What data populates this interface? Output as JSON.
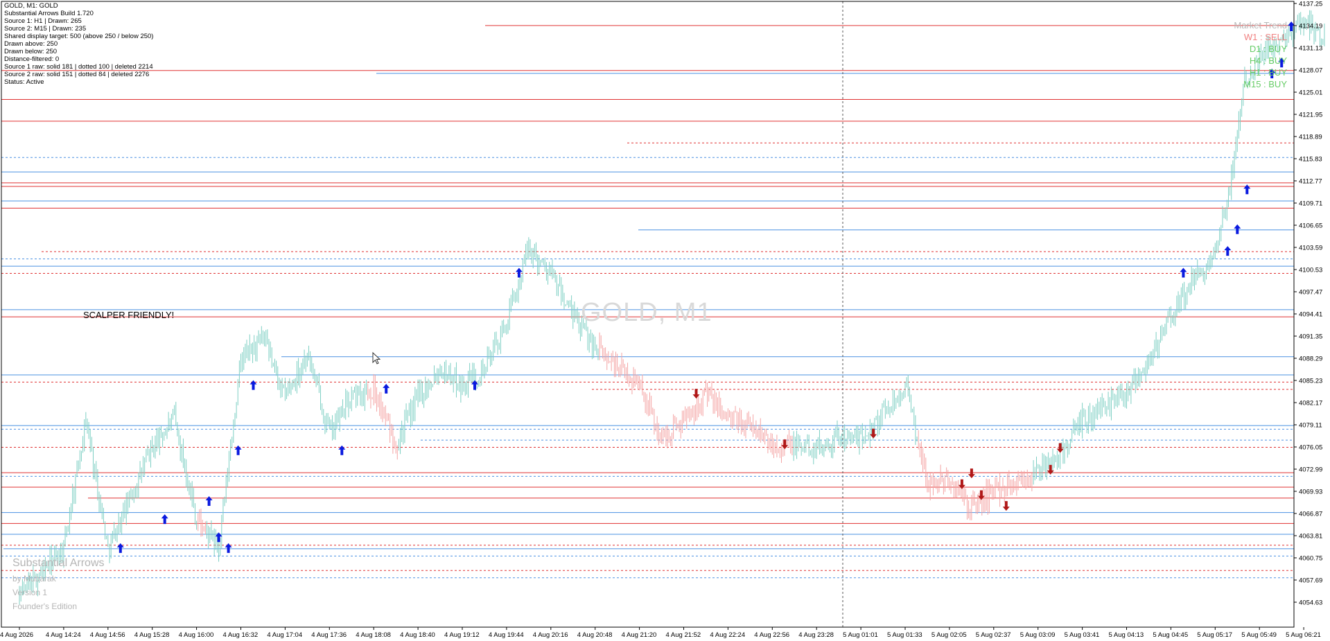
{
  "window": {
    "symbol": "GOLD, M1",
    "title_line": "GOLD, M1:  GOLD"
  },
  "info_panel": [
    "GOLD, M1:  GOLD",
    "Substantial Arrows Build 1.720",
    "Source 1: H1 | Drawn: 265",
    "Source 2: M15 | Drawn: 235",
    "Shared display target: 500 (above 250 / below 250)",
    "Drawn above: 250",
    "Drawn below: 250",
    "Distance-filtered: 0",
    "Source 1 raw: solid 181 | dotted 100 | deleted 2214",
    "Source 2 raw: solid 151 | dotted 84 | deleted 2276",
    "Status: Active"
  ],
  "scalper_text": "SCALPER FRIENDLY!",
  "watermark": "GOLD, M1",
  "branding": {
    "title": "Substantial Arrows",
    "author": "by Mubarak",
    "version": "Version 1",
    "edition": "Founder's Edition"
  },
  "trend_panel": [
    {
      "label": "Market Trend",
      "color": "#b8b8b8"
    },
    {
      "label": "W1 : SELL",
      "color": "#f08080"
    },
    {
      "label": "D1 : BUY",
      "color": "#66cc66"
    },
    {
      "label": "H4 : BUY",
      "color": "#66cc66"
    },
    {
      "label": "H1 : BUY",
      "color": "#66cc66"
    },
    {
      "label": "M15 : BUY",
      "color": "#66cc66"
    }
  ],
  "colors": {
    "bull": "#7dcfc3",
    "bear": "#f4a3a3",
    "resistance": "#e03030",
    "support": "#4a90e2",
    "arrow_up": "#0a1adf",
    "arrow_down": "#b01818"
  },
  "price_axis": {
    "labels": [
      "4137.25",
      "4134.19",
      "4131.13",
      "4128.07",
      "4125.01",
      "4121.95",
      "4118.89",
      "4115.83",
      "4112.77",
      "4109.71",
      "4106.65",
      "4103.59",
      "4100.53",
      "4097.47",
      "4094.41",
      "4091.35",
      "4088.29",
      "4085.23",
      "4082.17",
      "4079.11",
      "4076.05",
      "4072.99",
      "4069.93",
      "4066.87",
      "4063.81",
      "4060.75",
      "4057.69",
      "4054.63"
    ]
  },
  "time_axis": {
    "labels": [
      "4 Aug 2026",
      "4 Aug 14:24",
      "4 Aug 14:56",
      "4 Aug 15:28",
      "4 Aug 16:00",
      "4 Aug 16:32",
      "4 Aug 17:04",
      "4 Aug 17:36",
      "4 Aug 18:08",
      "4 Aug 18:40",
      "4 Aug 19:12",
      "4 Aug 19:44",
      "4 Aug 20:16",
      "4 Aug 20:48",
      "4 Aug 21:20",
      "4 Aug 21:52",
      "4 Aug 22:24",
      "4 Aug 22:56",
      "4 Aug 23:28",
      "5 Aug 01:01",
      "5 Aug 01:33",
      "5 Aug 02:05",
      "5 Aug 02:37",
      "5 Aug 03:09",
      "5 Aug 03:41",
      "5 Aug 04:13",
      "5 Aug 04:45",
      "5 Aug 05:17",
      "5 Aug 05:49",
      "5 Aug 06:21"
    ]
  },
  "chart_data": {
    "type": "candlestick",
    "symbol": "GOLD",
    "timeframe": "M1",
    "ylim": [
      4053.0,
      4138.0
    ],
    "y_ticks": [
      4137.25,
      4134.19,
      4131.13,
      4128.07,
      4125.01,
      4121.95,
      4118.89,
      4115.83,
      4112.77,
      4109.71,
      4106.65,
      4103.59,
      4100.53,
      4097.47,
      4094.41,
      4091.35,
      4088.29,
      4085.23,
      4082.17,
      4079.11,
      4076.05,
      4072.99,
      4069.93,
      4066.87,
      4063.81,
      4060.75,
      4057.69,
      4054.63
    ],
    "x_ticks": [
      "4 Aug 2026",
      "4 Aug 14:24",
      "4 Aug 14:56",
      "4 Aug 15:28",
      "4 Aug 16:00",
      "4 Aug 16:32",
      "4 Aug 17:04",
      "4 Aug 17:36",
      "4 Aug 18:08",
      "4 Aug 18:40",
      "4 Aug 19:12",
      "4 Aug 19:44",
      "4 Aug 20:16",
      "4 Aug 20:48",
      "4 Aug 21:20",
      "4 Aug 21:52",
      "4 Aug 22:24",
      "4 Aug 22:56",
      "4 Aug 23:28",
      "5 Aug 01:01",
      "5 Aug 01:33",
      "5 Aug 02:05",
      "5 Aug 02:37",
      "5 Aug 03:09",
      "5 Aug 03:41",
      "5 Aug 04:13",
      "5 Aug 04:45",
      "5 Aug 05:17",
      "5 Aug 05:49",
      "5 Aug 06:21"
    ],
    "price_path": [
      {
        "t": "4 Aug 2026",
        "p": 4055.5
      },
      {
        "t": "4 Aug 14:24",
        "p": 4062.0
      },
      {
        "t": "4 Aug 14:24",
        "p": 4080.0
      },
      {
        "t": "4 Aug 14:56",
        "p": 4062.0
      },
      {
        "t": "4 Aug 15:28",
        "p": 4076.0
      },
      {
        "t": "4 Aug 15:28",
        "p": 4080.0
      },
      {
        "t": "4 Aug 16:00",
        "p": 4066.0
      },
      {
        "t": "4 Aug 16:00",
        "p": 4062.0
      },
      {
        "t": "4 Aug 16:32",
        "p": 4088.0
      },
      {
        "t": "4 Aug 16:32",
        "p": 4091.0
      },
      {
        "t": "4 Aug 17:04",
        "p": 4083.0
      },
      {
        "t": "4 Aug 17:04",
        "p": 4089.0
      },
      {
        "t": "4 Aug 17:36",
        "p": 4078.0
      },
      {
        "t": "4 Aug 17:36",
        "p": 4083.0
      },
      {
        "t": "4 Aug 18:08",
        "p": 4084.0
      },
      {
        "t": "4 Aug 18:08",
        "p": 4076.5
      },
      {
        "t": "4 Aug 18:40",
        "p": 4083.0
      },
      {
        "t": "4 Aug 18:40",
        "p": 4087.0
      },
      {
        "t": "4 Aug 19:12",
        "p": 4084.5
      },
      {
        "t": "4 Aug 19:12",
        "p": 4087.0
      },
      {
        "t": "4 Aug 19:44",
        "p": 4093.0
      },
      {
        "t": "4 Aug 19:44",
        "p": 4103.5
      },
      {
        "t": "4 Aug 20:16",
        "p": 4100.0
      },
      {
        "t": "4 Aug 20:16",
        "p": 4094.0
      },
      {
        "t": "4 Aug 20:48",
        "p": 4090.0
      },
      {
        "t": "4 Aug 20:48",
        "p": 4087.0
      },
      {
        "t": "4 Aug 21:20",
        "p": 4085.0
      },
      {
        "t": "4 Aug 21:20",
        "p": 4077.0
      },
      {
        "t": "4 Aug 21:52",
        "p": 4080.0
      },
      {
        "t": "4 Aug 21:52",
        "p": 4083.5
      },
      {
        "t": "4 Aug 22:24",
        "p": 4080.0
      },
      {
        "t": "4 Aug 22:24",
        "p": 4079.0
      },
      {
        "t": "4 Aug 22:56",
        "p": 4076.5
      },
      {
        "t": "4 Aug 23:28",
        "p": 4076.0
      },
      {
        "t": "4 Aug 23:28",
        "p": 4077.5
      },
      {
        "t": "5 Aug 01:01",
        "p": 4077.0
      },
      {
        "t": "5 Aug 01:33",
        "p": 4084.5
      },
      {
        "t": "5 Aug 01:33",
        "p": 4071.0
      },
      {
        "t": "5 Aug 02:05",
        "p": 4071.5
      },
      {
        "t": "5 Aug 02:05",
        "p": 4067.5
      },
      {
        "t": "5 Aug 02:37",
        "p": 4070.0
      },
      {
        "t": "5 Aug 03:09",
        "p": 4072.5
      },
      {
        "t": "5 Aug 03:09",
        "p": 4075.0
      },
      {
        "t": "5 Aug 03:41",
        "p": 4079.5
      },
      {
        "t": "5 Aug 04:13",
        "p": 4084.0
      },
      {
        "t": "5 Aug 04:13",
        "p": 4088.0
      },
      {
        "t": "5 Aug 04:45",
        "p": 4094.0
      },
      {
        "t": "5 Aug 04:45",
        "p": 4099.0
      },
      {
        "t": "5 Aug 05:17",
        "p": 4102.0
      },
      {
        "t": "5 Aug 05:17",
        "p": 4112.0
      },
      {
        "t": "5 Aug 05:17",
        "p": 4127.0
      },
      {
        "t": "5 Aug 05:49",
        "p": 4130.0
      },
      {
        "t": "5 Aug 06:21",
        "p": 4135.0
      },
      {
        "t": "5 Aug 06:21",
        "p": 4132.5
      }
    ],
    "resistance_levels": [
      {
        "price": 4134.2,
        "style": "solid"
      },
      {
        "price": 4128.0,
        "style": "solid"
      },
      {
        "price": 4124.0,
        "style": "solid"
      },
      {
        "price": 4121.0,
        "style": "solid"
      },
      {
        "price": 4118.0,
        "style": "dotted"
      },
      {
        "price": 4112.5,
        "style": "solid"
      },
      {
        "price": 4112.0,
        "style": "solid"
      },
      {
        "price": 4109.0,
        "style": "solid"
      },
      {
        "price": 4103.0,
        "style": "dotted"
      },
      {
        "price": 4100.0,
        "style": "dotted"
      },
      {
        "price": 4094.0,
        "style": "solid"
      },
      {
        "price": 4085.0,
        "style": "dotted"
      },
      {
        "price": 4084.0,
        "style": "dotted"
      },
      {
        "price": 4076.0,
        "style": "dotted"
      },
      {
        "price": 4072.5,
        "style": "solid"
      },
      {
        "price": 4070.5,
        "style": "solid"
      },
      {
        "price": 4069.0,
        "style": "solid"
      },
      {
        "price": 4065.5,
        "style": "solid"
      },
      {
        "price": 4062.5,
        "style": "dotted"
      },
      {
        "price": 4059.0,
        "style": "dotted"
      }
    ],
    "support_levels": [
      {
        "price": 4127.6,
        "style": "solid"
      },
      {
        "price": 4116.0,
        "style": "dotted"
      },
      {
        "price": 4114.0,
        "style": "solid"
      },
      {
        "price": 4110.0,
        "style": "solid"
      },
      {
        "price": 4106.0,
        "style": "solid"
      },
      {
        "price": 4102.0,
        "style": "dotted"
      },
      {
        "price": 4101.0,
        "style": "solid"
      },
      {
        "price": 4095.0,
        "style": "solid"
      },
      {
        "price": 4088.5,
        "style": "solid"
      },
      {
        "price": 4086.0,
        "style": "solid"
      },
      {
        "price": 4079.0,
        "style": "solid"
      },
      {
        "price": 4078.5,
        "style": "dotted"
      },
      {
        "price": 4077.0,
        "style": "dotted"
      },
      {
        "price": 4072.0,
        "style": "dotted"
      },
      {
        "price": 4067.0,
        "style": "solid"
      },
      {
        "price": 4064.0,
        "style": "solid"
      },
      {
        "price": 4062.0,
        "style": "solid"
      },
      {
        "price": 4061.0,
        "style": "dotted"
      },
      {
        "price": 4058.0,
        "style": "dotted"
      }
    ],
    "buy_arrows": [
      {
        "t": "4 Aug 14:56",
        "p": 4062.0
      },
      {
        "t": "4 Aug 15:28",
        "p": 4066.0
      },
      {
        "t": "4 Aug 16:00",
        "p": 4068.5
      },
      {
        "t": "4 Aug 16:00",
        "p": 4063.5
      },
      {
        "t": "4 Aug 16:00",
        "p": 4062.0
      },
      {
        "t": "4 Aug 16:00",
        "p": 4075.5
      },
      {
        "t": "4 Aug 16:32",
        "p": 4084.5
      },
      {
        "t": "4 Aug 17:36",
        "p": 4075.5
      },
      {
        "t": "4 Aug 18:08",
        "p": 4084.0
      },
      {
        "t": "4 Aug 19:12",
        "p": 4084.5
      },
      {
        "t": "4 Aug 19:44",
        "p": 4100.0
      },
      {
        "t": "5 Aug 04:45",
        "p": 4100.0
      },
      {
        "t": "5 Aug 05:17",
        "p": 4103.0
      },
      {
        "t": "5 Aug 05:17",
        "p": 4106.0
      },
      {
        "t": "5 Aug 05:17",
        "p": 4111.5
      },
      {
        "t": "5 Aug 05:49",
        "p": 4127.5
      },
      {
        "t": "5 Aug 05:49",
        "p": 4129.0
      },
      {
        "t": "5 Aug 05:49",
        "p": 4134.0
      }
    ],
    "sell_arrows": [
      {
        "t": "4 Aug 21:52",
        "p": 4083.5
      },
      {
        "t": "4 Aug 22:56",
        "p": 4076.5
      },
      {
        "t": "5 Aug 01:01",
        "p": 4078.0
      },
      {
        "t": "5 Aug 02:05",
        "p": 4071.0
      },
      {
        "t": "5 Aug 02:05",
        "p": 4072.5
      },
      {
        "t": "5 Aug 02:05",
        "p": 4069.5
      },
      {
        "t": "5 Aug 02:37",
        "p": 4068.0
      },
      {
        "t": "5 Aug 03:09",
        "p": 4073.0
      },
      {
        "t": "5 Aug 03:09",
        "p": 4076.0
      }
    ]
  }
}
